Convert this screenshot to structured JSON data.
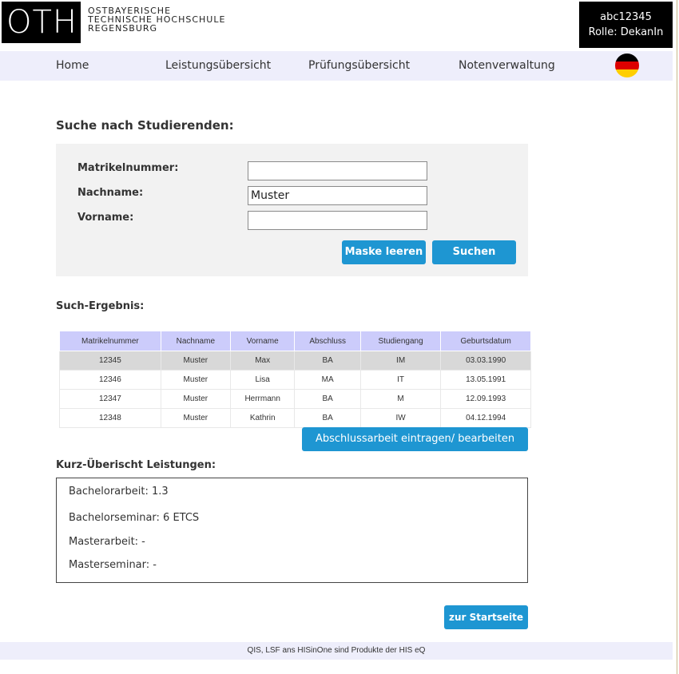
{
  "header": {
    "logo": "OTH",
    "logo_lines": [
      "OSTBAYERISCHE",
      "TECHNISCHE HOCHSCHULE",
      "REGENSBURG"
    ],
    "user_id": "abc12345",
    "role": "Rolle: DekanIn"
  },
  "nav": {
    "items": [
      "Home",
      "Leistungsübersicht",
      "Prüfungsübersicht",
      "Notenverwaltung"
    ],
    "language_flag": "german-flag-icon"
  },
  "search": {
    "title": "Suche nach Studierenden:",
    "labels": {
      "matrikel": "Matrikelnummer:",
      "nachname": "Nachname:",
      "vorname": "Vorname:"
    },
    "values": {
      "matrikel": "",
      "nachname": "Muster",
      "vorname": ""
    },
    "clear_button": "Maske leeren",
    "search_button": "Suchen"
  },
  "results": {
    "title": "Such-Ergebnis:",
    "columns": [
      "Matrikelnummer",
      "Nachname",
      "Vorname",
      "Abschluss",
      "Studiengang",
      "Geburtsdatum"
    ],
    "rows": [
      [
        "12345",
        "Muster",
        "Max",
        "BA",
        "IM",
        "03.03.1990"
      ],
      [
        "12346",
        "Muster",
        "Lisa",
        "MA",
        "IT",
        "13.05.1991"
      ],
      [
        "12347",
        "Muster",
        "Herrmann",
        "BA",
        "M",
        "12.09.1993"
      ],
      [
        "12348",
        "Muster",
        "Kathrin",
        "BA",
        "IW",
        "04.12.1994"
      ]
    ],
    "selected_row": 0,
    "thesis_button": "Abschlussarbeit eintragen/ bearbeiten"
  },
  "summary": {
    "title": "Kurz-Überischt Leistungen:",
    "lines": [
      "Bachelorarbeit: 1.3",
      "Bachelorseminar: 6 ETCS",
      "Masterarbeit: -",
      "Masterseminar: -"
    ]
  },
  "home_button": "zur Startseite",
  "footer": "QIS, LSF ans HISinOne sind Produkte der HIS eQ",
  "colors": {
    "accent": "#1e96d2",
    "nav_bg": "#eeeefb",
    "table_header": "#ccccfb",
    "selected_row": "#d8d8d8"
  }
}
